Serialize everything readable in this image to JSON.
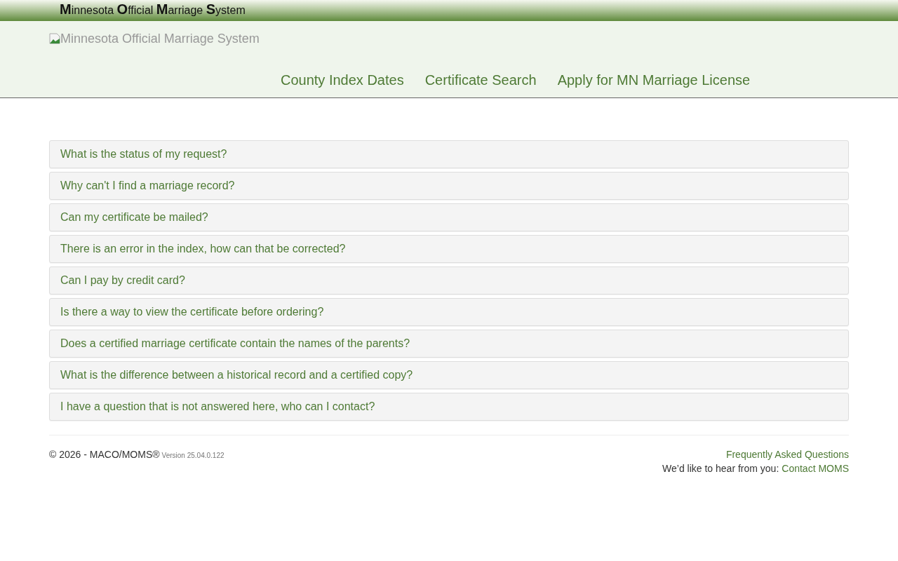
{
  "banner": {
    "title": "**M**innesota **O**fficial **M**arriage **S**ystem"
  },
  "header": {
    "logo_alt": "Minnesota Official Marriage System",
    "nav": [
      {
        "label": "County Index Dates"
      },
      {
        "label": "Certificate Search"
      },
      {
        "label": "Apply for MN Marriage License"
      }
    ]
  },
  "faq": [
    {
      "question": "What is the status of my request?",
      "expanded": false
    },
    {
      "question": "Why can't I find a marriage record?",
      "expanded": false
    },
    {
      "question": "Can my certificate be mailed?",
      "expanded": false
    },
    {
      "question": "There is an error in the index, how can that be corrected?",
      "expanded": false
    },
    {
      "question": "Can I pay by credit card?",
      "expanded": false
    },
    {
      "question": "Is there a way to view the certificate before ordering?",
      "expanded": false
    },
    {
      "question": "Does a certified marriage certificate contain the names of the parents?",
      "expanded": false
    },
    {
      "question": "What is the difference between a historical record and a certified copy?",
      "expanded": false
    },
    {
      "question": "I have a question that is not answered here, who can I contact?",
      "expanded": false
    }
  ],
  "footer": {
    "copyright": "© 2026 - MACO/MOMS®",
    "version": "Version 25.04.0.122",
    "faq_link": "Frequently Asked Questions",
    "contact_text": "We’d like to hear from you:",
    "contact_link": "Contact MOMS"
  }
}
